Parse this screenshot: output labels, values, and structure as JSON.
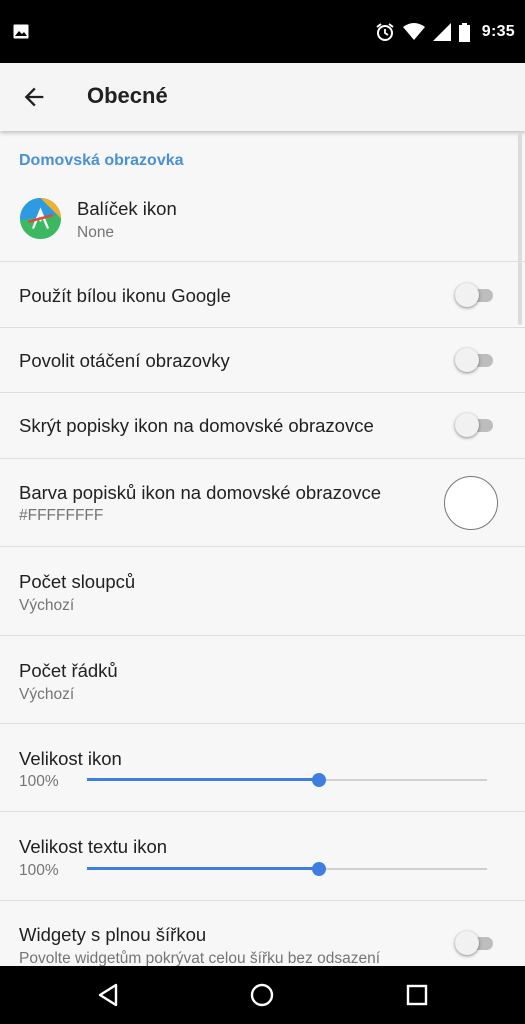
{
  "status_bar": {
    "time": "9:35",
    "icons": [
      "gallery-icon",
      "alarm-icon",
      "wifi-icon",
      "signal-icon",
      "battery-icon"
    ]
  },
  "app_bar": {
    "title": "Obecné",
    "back_icon": "arrow-back-icon"
  },
  "section": {
    "header": "Domovská obrazovka",
    "header_color": "#4a90d9"
  },
  "settings": {
    "icon_pack": {
      "title": "Balíček ikon",
      "value": "None",
      "icon": "icon-pack-icon"
    },
    "white_google": {
      "title": "Použít bílou ikonu Google",
      "enabled": false
    },
    "rotation": {
      "title": "Povolit otáčení obrazovky",
      "enabled": false
    },
    "hide_labels": {
      "title": "Skrýt popisky ikon na domovské obrazovce",
      "enabled": false
    },
    "label_color": {
      "title": "Barva popisků ikon na domovské obrazovce",
      "value": "#FFFFFFFF",
      "swatch": "#ffffff"
    },
    "columns": {
      "title": "Počet sloupců",
      "value": "Výchozí"
    },
    "rows": {
      "title": "Počet řádků",
      "value": "Výchozí"
    },
    "icon_size": {
      "title": "Velikost ikon",
      "value": "100%",
      "position": 0.58
    },
    "text_size": {
      "title": "Velikost textu ikon",
      "value": "100%",
      "position": 0.58
    },
    "full_width_widgets": {
      "title": "Widgety s plnou šířkou",
      "summary": "Povolte widgetům pokrývat celou šířku bez odsazení",
      "enabled": false
    }
  },
  "nav_bar": {
    "icons": [
      "back-triangle-icon",
      "home-circle-icon",
      "recents-square-icon"
    ]
  },
  "colors": {
    "accent": "#3f7ee0",
    "status_bar_bg": "#000000",
    "app_bar_bg": "#f5f5f5"
  }
}
